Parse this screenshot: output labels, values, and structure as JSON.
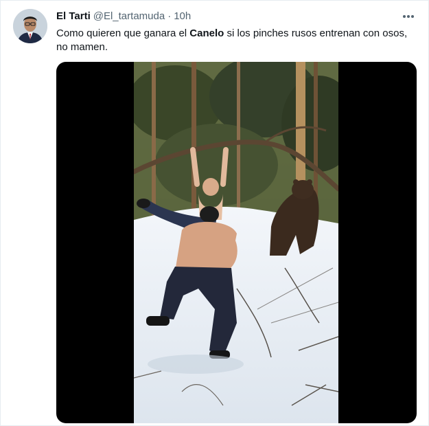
{
  "tweet": {
    "display_name": "El Tarti",
    "handle": "@El_tartamuda",
    "separator": "·",
    "time": "10h",
    "text_part1": "Como quieren que ganara el ",
    "text_bold": "Canelo",
    "text_part2": " si los pinches rusos entrenan con osos, no mamen."
  },
  "icons": {
    "more": "more-horizontal-icon",
    "avatar": "user-avatar"
  },
  "colors": {
    "secondary_text": "#536471",
    "media_background": "#000000",
    "snow": "#e9eef4",
    "forest": "#3d4a2a"
  }
}
